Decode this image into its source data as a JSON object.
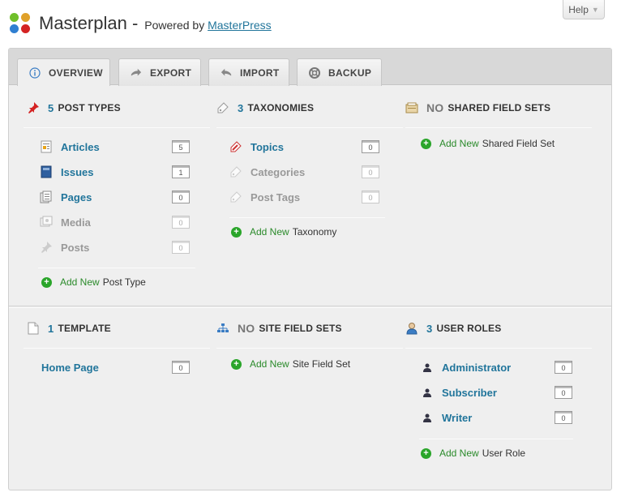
{
  "header": {
    "title": "Masterplan -",
    "powered_prefix": "Powered by",
    "powered_link": "MasterPress",
    "help_label": "Help"
  },
  "tabs": [
    {
      "label": "OVERVIEW",
      "icon": "info-icon",
      "active": true
    },
    {
      "label": "EXPORT",
      "icon": "export-arrow-icon",
      "active": false
    },
    {
      "label": "IMPORT",
      "icon": "import-arrow-icon",
      "active": false
    },
    {
      "label": "BACKUP",
      "icon": "lifebuoy-icon",
      "active": false
    }
  ],
  "post_types": {
    "count": "5",
    "heading": "POST TYPES",
    "items": [
      {
        "label": "Articles",
        "count": "5",
        "icon": "article-icon",
        "dim": false
      },
      {
        "label": "Issues",
        "count": "1",
        "icon": "book-icon",
        "dim": false
      },
      {
        "label": "Pages",
        "count": "0",
        "icon": "pages-icon",
        "dim": false
      },
      {
        "label": "Media",
        "count": "0",
        "icon": "media-icon",
        "dim": true
      },
      {
        "label": "Posts",
        "count": "0",
        "icon": "pin-icon",
        "dim": true
      }
    ],
    "add_new": "Add New",
    "add_what": "Post Type"
  },
  "taxonomies": {
    "count": "3",
    "heading": "TAXONOMIES",
    "items": [
      {
        "label": "Topics",
        "count": "0",
        "icon": "tag-icon",
        "dim": false
      },
      {
        "label": "Categories",
        "count": "0",
        "icon": "tag-icon",
        "dim": true
      },
      {
        "label": "Post Tags",
        "count": "0",
        "icon": "tag-icon",
        "dim": true
      }
    ],
    "add_new": "Add New",
    "add_what": "Taxonomy"
  },
  "shared_field_sets": {
    "count": "NO",
    "heading": "SHARED FIELD SETS",
    "add_new": "Add New",
    "add_what": "Shared Field Set"
  },
  "templates": {
    "count": "1",
    "heading": "TEMPLATE",
    "items": [
      {
        "label": "Home Page",
        "count": "0"
      }
    ]
  },
  "site_field_sets": {
    "count": "NO",
    "heading": "SITE FIELD SETS",
    "add_new": "Add New",
    "add_what": "Site Field Set"
  },
  "user_roles": {
    "count": "3",
    "heading": "USER ROLES",
    "items": [
      {
        "label": "Administrator",
        "count": "0"
      },
      {
        "label": "Subscriber",
        "count": "0"
      },
      {
        "label": "Writer",
        "count": "0"
      }
    ],
    "add_new": "Add New",
    "add_what": "User Role"
  }
}
